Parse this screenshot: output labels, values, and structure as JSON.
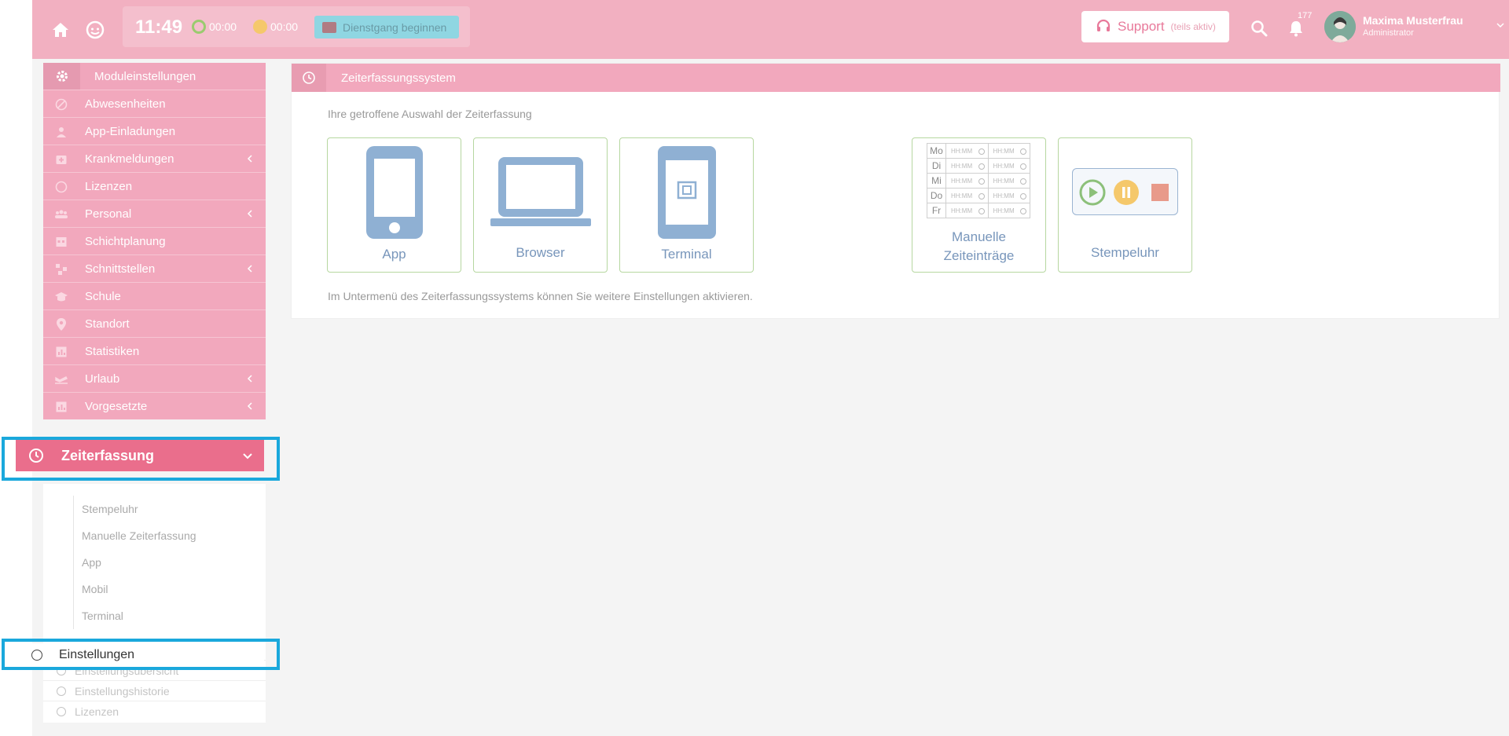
{
  "header": {
    "clock": "11:49",
    "timer_work": "00:00",
    "timer_break": "00:00",
    "trip_button": "Dienstgang beginnen",
    "support_label": "Support",
    "support_sub": "(teils aktiv)",
    "notification_count": "177",
    "user_name": "Maxima Musterfrau",
    "user_role": "Administrator"
  },
  "sidebar": {
    "title": "Moduleinstellungen",
    "items": [
      {
        "label": "Abwesenheiten",
        "icon": "ban-icon",
        "chevron": false
      },
      {
        "label": "App-Einladungen",
        "icon": "user-icon",
        "chevron": false
      },
      {
        "label": "Krankmeldungen",
        "icon": "medical-icon",
        "chevron": true
      },
      {
        "label": "Lizenzen",
        "icon": "circle-icon",
        "chevron": false
      },
      {
        "label": "Personal",
        "icon": "users-icon",
        "chevron": true
      },
      {
        "label": "Schichtplanung",
        "icon": "calendar-icon",
        "chevron": false
      },
      {
        "label": "Schnittstellen",
        "icon": "sitemap-icon",
        "chevron": true
      },
      {
        "label": "Schule",
        "icon": "graduation-icon",
        "chevron": false
      },
      {
        "label": "Standort",
        "icon": "pin-icon",
        "chevron": false
      },
      {
        "label": "Statistiken",
        "icon": "chart-icon",
        "chevron": false
      },
      {
        "label": "Urlaub",
        "icon": "plane-icon",
        "chevron": true
      },
      {
        "label": "Vorgesetzte",
        "icon": "chart-icon",
        "chevron": true
      }
    ],
    "active": "Zeiterfassung",
    "submenu": [
      "Stempeluhr",
      "Manuelle Zeiterfassung",
      "App",
      "Mobil",
      "Terminal"
    ],
    "einstellungen": "Einstellungen",
    "ghost_items": [
      "Einstellungsübersicht",
      "Einstellungshistorie",
      "Lizenzen"
    ]
  },
  "main": {
    "panel_title": "Zeiterfassungssystem",
    "selection_label": "Ihre getroffene Auswahl der Zeiterfassung",
    "cards": {
      "app": "App",
      "browser": "Browser",
      "terminal": "Terminal",
      "manual_line1": "Manuelle",
      "manual_line2": "Zeiteinträge",
      "stamp": "Stempeluhr"
    },
    "weekdays": [
      "Mo",
      "Di",
      "Mi",
      "Do",
      "Fr"
    ],
    "slot_placeholder": "HH:MM",
    "info_text": "Im Untermenü des Zeiterfassungssystems können Sie weitere Einstellungen aktivieren."
  },
  "colors": {
    "header": "#f2b0c1",
    "active_item": "#ea6e8c",
    "highlight": "#1aa8dc",
    "card_border": "#b6d7a0",
    "card_icon": "#8fb0d3"
  }
}
